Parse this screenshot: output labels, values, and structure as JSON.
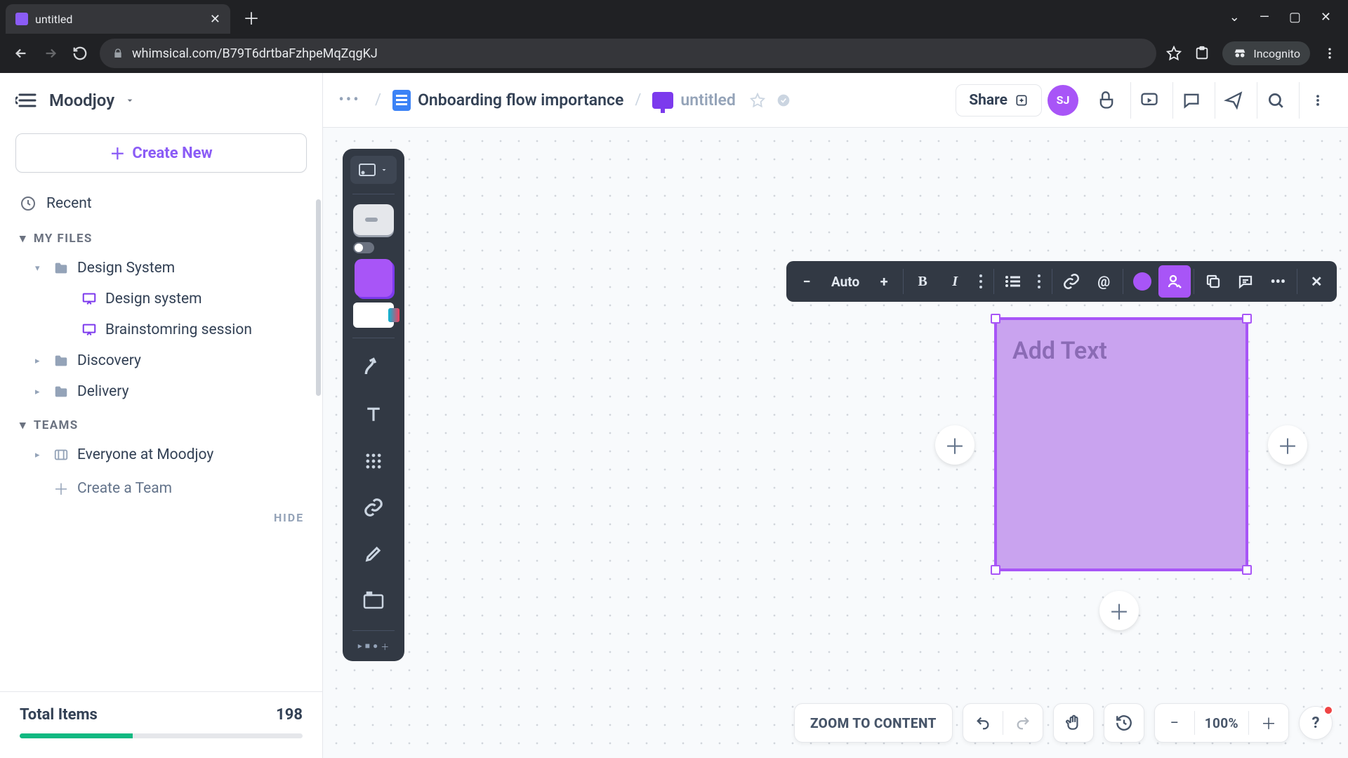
{
  "browser": {
    "tab_title": "untitled",
    "url": "whimsical.com/B79T6drtbaFzhpeMqZqgKJ",
    "incognito_label": "Incognito"
  },
  "workspace": {
    "name": "Moodjoy"
  },
  "sidebar": {
    "create_label": "Create New",
    "recent_label": "Recent",
    "section_files": "MY FILES",
    "section_teams": "TEAMS",
    "files": {
      "design_system_folder": "Design System",
      "design_system_board": "Design system",
      "brainstorming_board": "Brainstomring session",
      "discovery_folder": "Discovery",
      "delivery_folder": "Delivery"
    },
    "teams": {
      "everyone": "Everyone at Moodjoy",
      "create_team": "Create a Team"
    },
    "hide_label": "HIDE",
    "total_label": "Total Items",
    "total_count": "198"
  },
  "breadcrumb": {
    "parent": "Onboarding flow importance",
    "current": "untitled"
  },
  "topbar": {
    "share": "Share",
    "avatar_initials": "SJ"
  },
  "format_bar": {
    "size_label": "Auto"
  },
  "sticky": {
    "placeholder": "Add Text"
  },
  "bottom": {
    "zoom_to_content": "ZOOM TO CONTENT",
    "zoom_level": "100%"
  }
}
